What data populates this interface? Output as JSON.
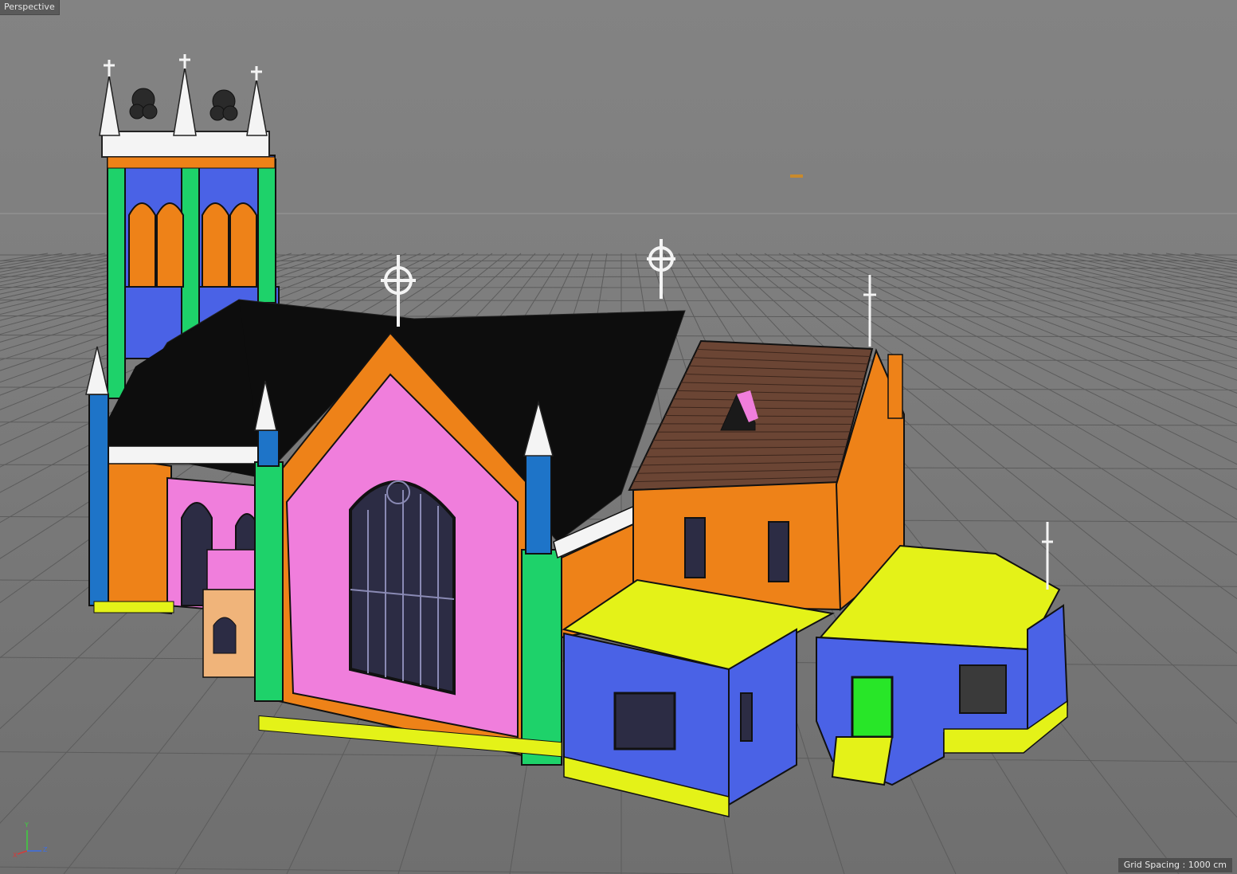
{
  "viewport": {
    "view_label": "Perspective",
    "grid_spacing_text": "Grid Spacing : 1000 cm"
  },
  "axis": {
    "y_label": "Y",
    "x_label": "X",
    "z_label": "Z",
    "y_color": "#3cd23c",
    "x_color": "#d23c3c",
    "z_color": "#3c6ee6"
  },
  "colors": {
    "roof": "#0d0d0d",
    "tile_roof": "#6b4534",
    "pink_gable": "#f07edc",
    "orange": "#ee8218",
    "blue": "#4a62e6",
    "yellow": "#e4f218",
    "green": "#1ed26a",
    "cyan_blue": "#1e74c8",
    "white": "#f4f4f4",
    "door_green": "#28e628",
    "window": "#2c2c44",
    "sky_grey": "#7f7f7f"
  }
}
